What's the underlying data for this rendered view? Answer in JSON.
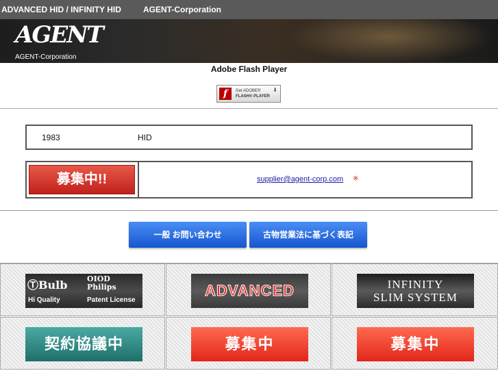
{
  "topbar": {
    "item1": "ADVANCED HID / INFINITY HID",
    "item2": "AGENT-Corporation"
  },
  "header": {
    "logo_text": "AGENT",
    "logo_subtitle": "AGENT-Corporation"
  },
  "flash": {
    "title": "Adobe Flash Player",
    "badge_line1": "Get ADOBE®",
    "badge_line2": "FLASH® PLAYER"
  },
  "info_box": {
    "year": "1983",
    "hid": "HID"
  },
  "recruit_box": {
    "banner_label": "募集中!!",
    "email": "supplier@agent-corp.com",
    "email_suffix": "※"
  },
  "buttons": {
    "contact": "一般 お問い合わせ",
    "notice": "古物営業法に基づく表記"
  },
  "banners": {
    "bulb_line1": "Bulb",
    "bulb_line2": "OIOD Philips",
    "bulb_line3": "Hi Quality",
    "bulb_line4": "Patent License",
    "advanced": "ADVANCED",
    "infinity_line1": "INFINITY",
    "infinity_line2": "SLIM SYSTEM",
    "contract": "契約協議中",
    "recruit_a": "募集中",
    "recruit_b": "募集中"
  },
  "colors": {
    "topbar_bg": "#5a5a5a",
    "blue_button": "#1556cf",
    "recruit_red": "#e2261a",
    "teal": "#1f6f6a",
    "link": "#1a1aa8"
  }
}
